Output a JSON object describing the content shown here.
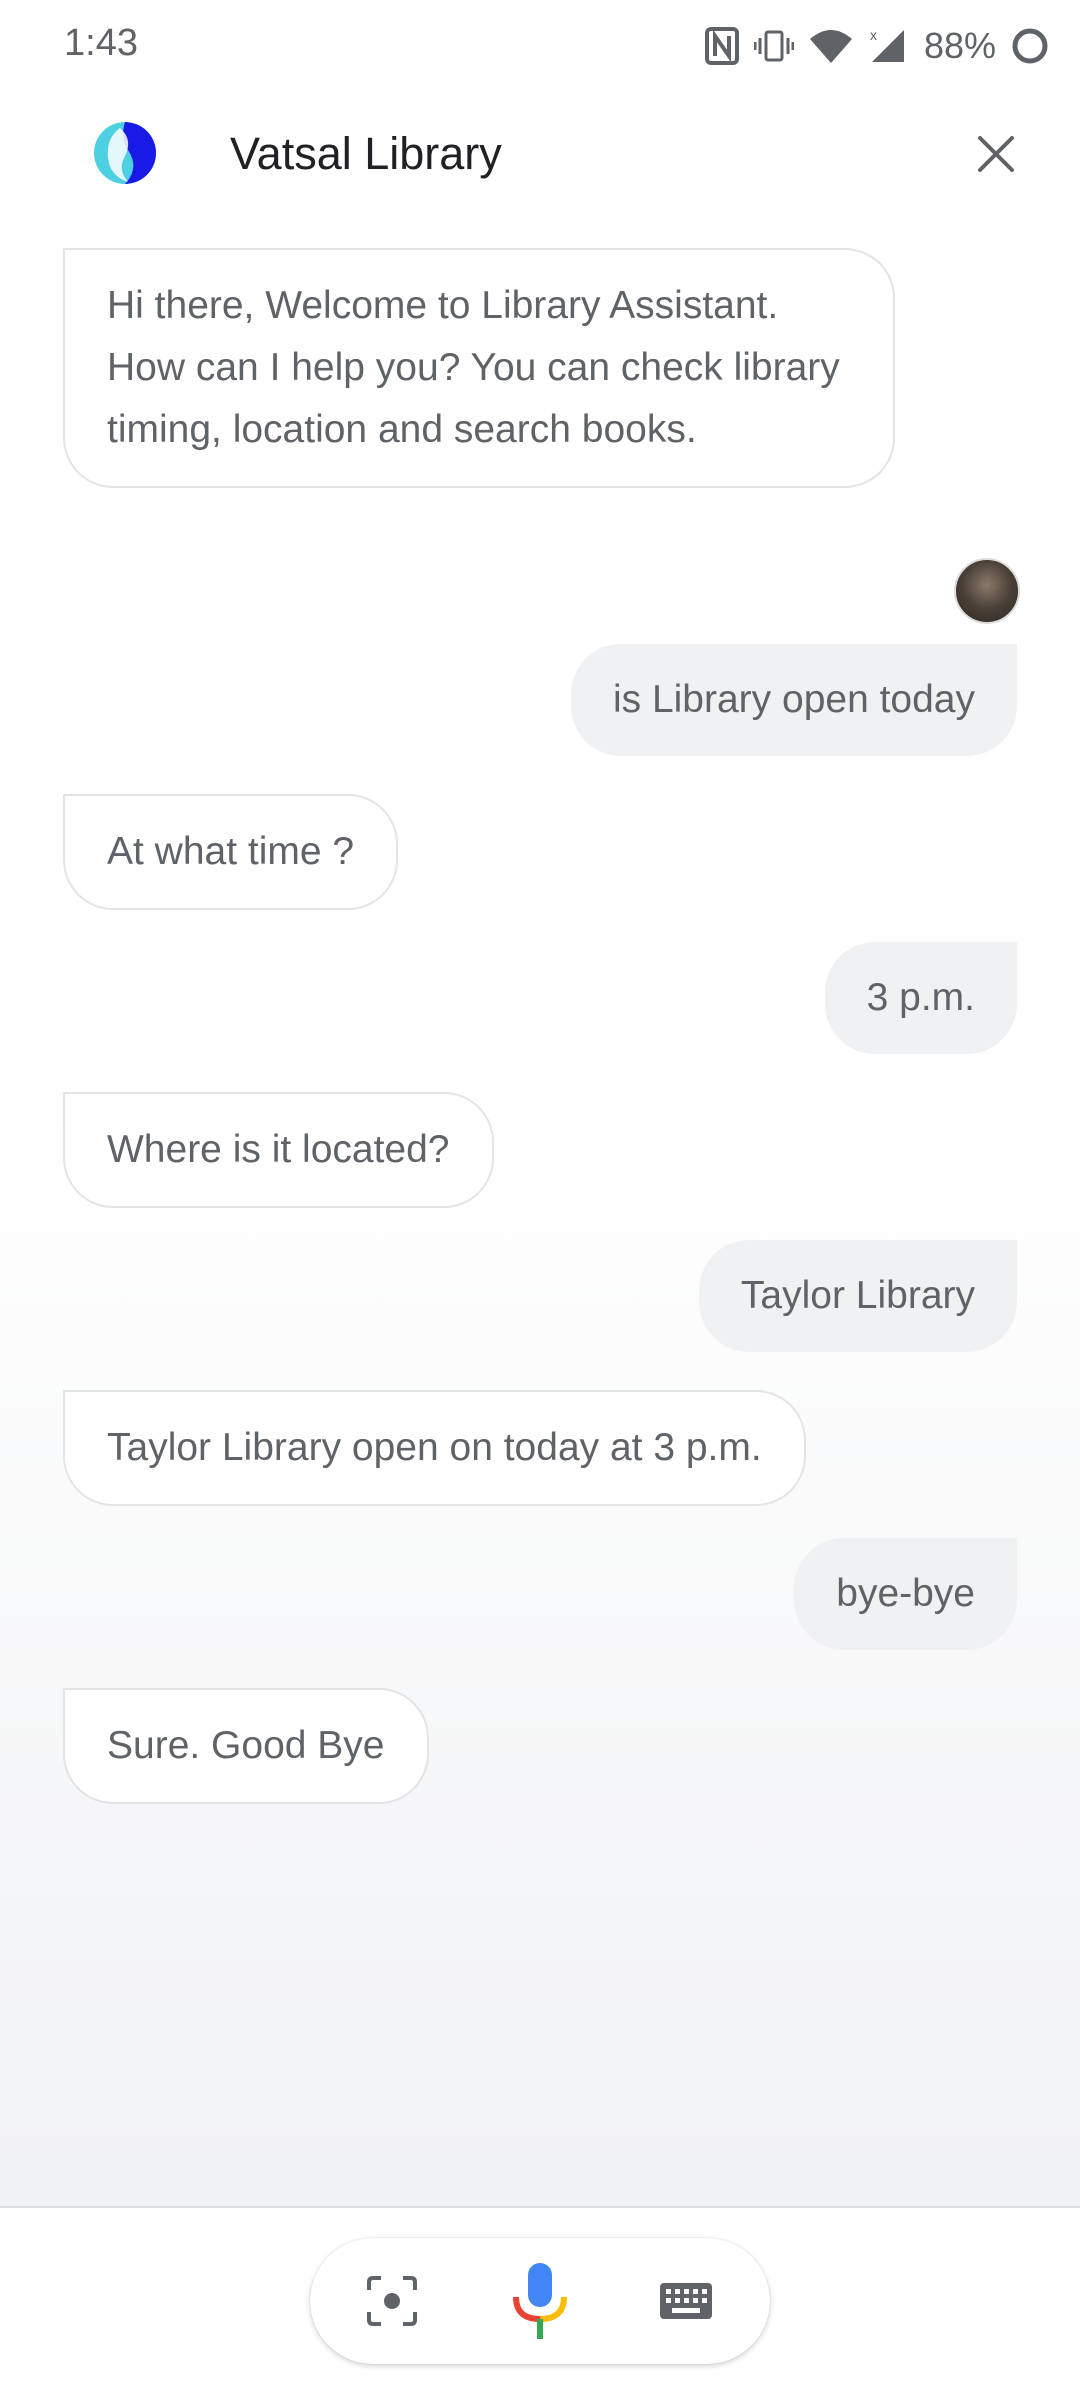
{
  "status_bar": {
    "time": "1:43",
    "battery_percent": "88%",
    "icons": [
      "nfc-icon",
      "vibrate-icon",
      "wifi-icon",
      "cell-signal-icon",
      "battery-ring-icon"
    ]
  },
  "header": {
    "title": "Vatsal Library",
    "logo_icon": "vatsal-library-logo",
    "close_icon": "close-icon"
  },
  "messages": [
    {
      "sender": "bot",
      "text": "Hi there, Welcome to Library Assistant. How can I help you? You can check library timing, location and search books."
    },
    {
      "sender": "user",
      "text": "is Library open today"
    },
    {
      "sender": "bot",
      "text": "At what time ?"
    },
    {
      "sender": "user",
      "text": "3 p.m."
    },
    {
      "sender": "bot",
      "text": "Where is it located?"
    },
    {
      "sender": "user",
      "text": "Taylor Library"
    },
    {
      "sender": "bot",
      "text": "Taylor Library open on today at 3 p.m."
    },
    {
      "sender": "user",
      "text": "bye-bye"
    },
    {
      "sender": "bot",
      "text": "Sure. Good Bye"
    }
  ],
  "bottom_bar": {
    "buttons": [
      "lens-icon",
      "mic-icon",
      "keyboard-icon"
    ]
  },
  "colors": {
    "mic_blue": "#4285f4",
    "mic_red": "#ea4335",
    "mic_yellow": "#fbbc04",
    "mic_green": "#34a853",
    "user_bubble": "#f0f1f3",
    "text": "#5f6368"
  }
}
